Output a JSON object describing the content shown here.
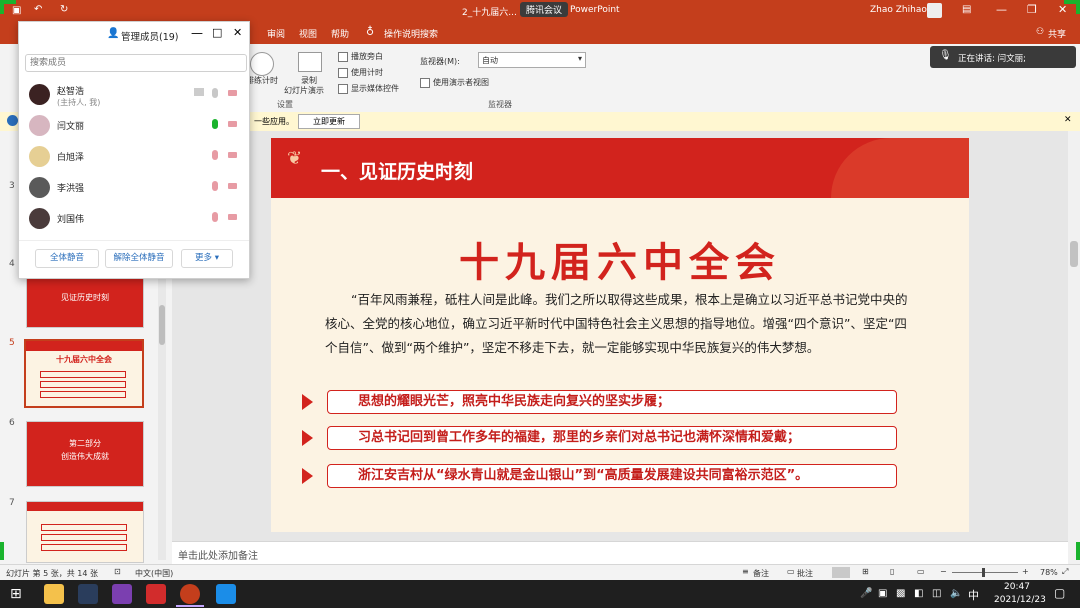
{
  "window": {
    "doc_title": "2_十九届六...",
    "app_title": "PowerPoint",
    "meeting_label": "腾讯会议",
    "user_name": "Zhao Zhihao",
    "share_label": "共享"
  },
  "ribbon": {
    "tabs": [
      "审阅",
      "视图",
      "帮助"
    ],
    "tell_me": "操作说明搜索",
    "rehearse_label": "排练计时",
    "record_label": "录制",
    "record_sub": "幻灯片演示",
    "check_narration": "播放旁白",
    "check_timing": "使用计时",
    "check_media": "显示媒体控件",
    "group_setup": "设置",
    "monitor_label": "监视器(M):",
    "monitor_value": "自动",
    "presenter_view": "使用演示者视图",
    "group_monitor": "监视器"
  },
  "speaking": {
    "label": "正在讲话: 闫文丽;"
  },
  "infobar": {
    "text": "一些应用。",
    "button": "立即更新"
  },
  "members_panel": {
    "title": "管理成员(19)",
    "search_placeholder": "搜索成员",
    "members": [
      {
        "name": "赵智浩",
        "role": "(主持人, 我)"
      },
      {
        "name": "闫文丽",
        "role": ""
      },
      {
        "name": "白旭泽",
        "role": ""
      },
      {
        "name": "李洪强",
        "role": ""
      },
      {
        "name": "刘国伟",
        "role": ""
      }
    ],
    "mute_all": "全体静音",
    "unmute_all": "解除全体静音",
    "more": "更多"
  },
  "slides_panel": {
    "numbers": [
      "3",
      "4",
      "5",
      "6",
      "7"
    ],
    "slide4_text": "见证历史时刻",
    "slide5_title": "十九届六中全会",
    "slide6_line1": "第二部分",
    "slide6_line2": "创造伟大成就"
  },
  "slide": {
    "header": "一、见证历史时刻",
    "big_title": "十九届六中全会",
    "paragraph": "“百年风雨兼程，砥柱人间是此峰。我们之所以取得这些成果，根本上是确立以习近平总书记党中央的核心、全党的核心地位，确立习近平新时代中国特色社会主义思想的指导地位。增强“四个意识”、坚定“四个自信”、做到“两个维护”，坚定不移走下去，就一定能够实现中华民族复兴的伟大梦想。",
    "bullets": [
      "思想的耀眼光芒，照亮中华民族走向复兴的坚实步履；",
      "习总书记回到曾工作多年的福建，那里的乡亲们对总书记也满怀深情和爱戴；",
      "浙江安吉村从“绿水青山就是金山银山”到“高质量发展建设共同富裕示范区”。"
    ]
  },
  "notes": {
    "placeholder": "单击此处添加备注"
  },
  "status": {
    "slide_info": "幻灯片 第 5 张，共 14 张",
    "language": "中文(中国)",
    "notes_btn": "备注",
    "comments_btn": "批注",
    "zoom": "78%"
  },
  "taskbar": {
    "ime": "中",
    "time": "20:47",
    "date": "2021/12/23"
  },
  "colors": {
    "accent": "#c43e1c",
    "slide_red": "#d2231d",
    "slide_bg": "#fcf3e3",
    "active_mic": "#1ab32d"
  }
}
